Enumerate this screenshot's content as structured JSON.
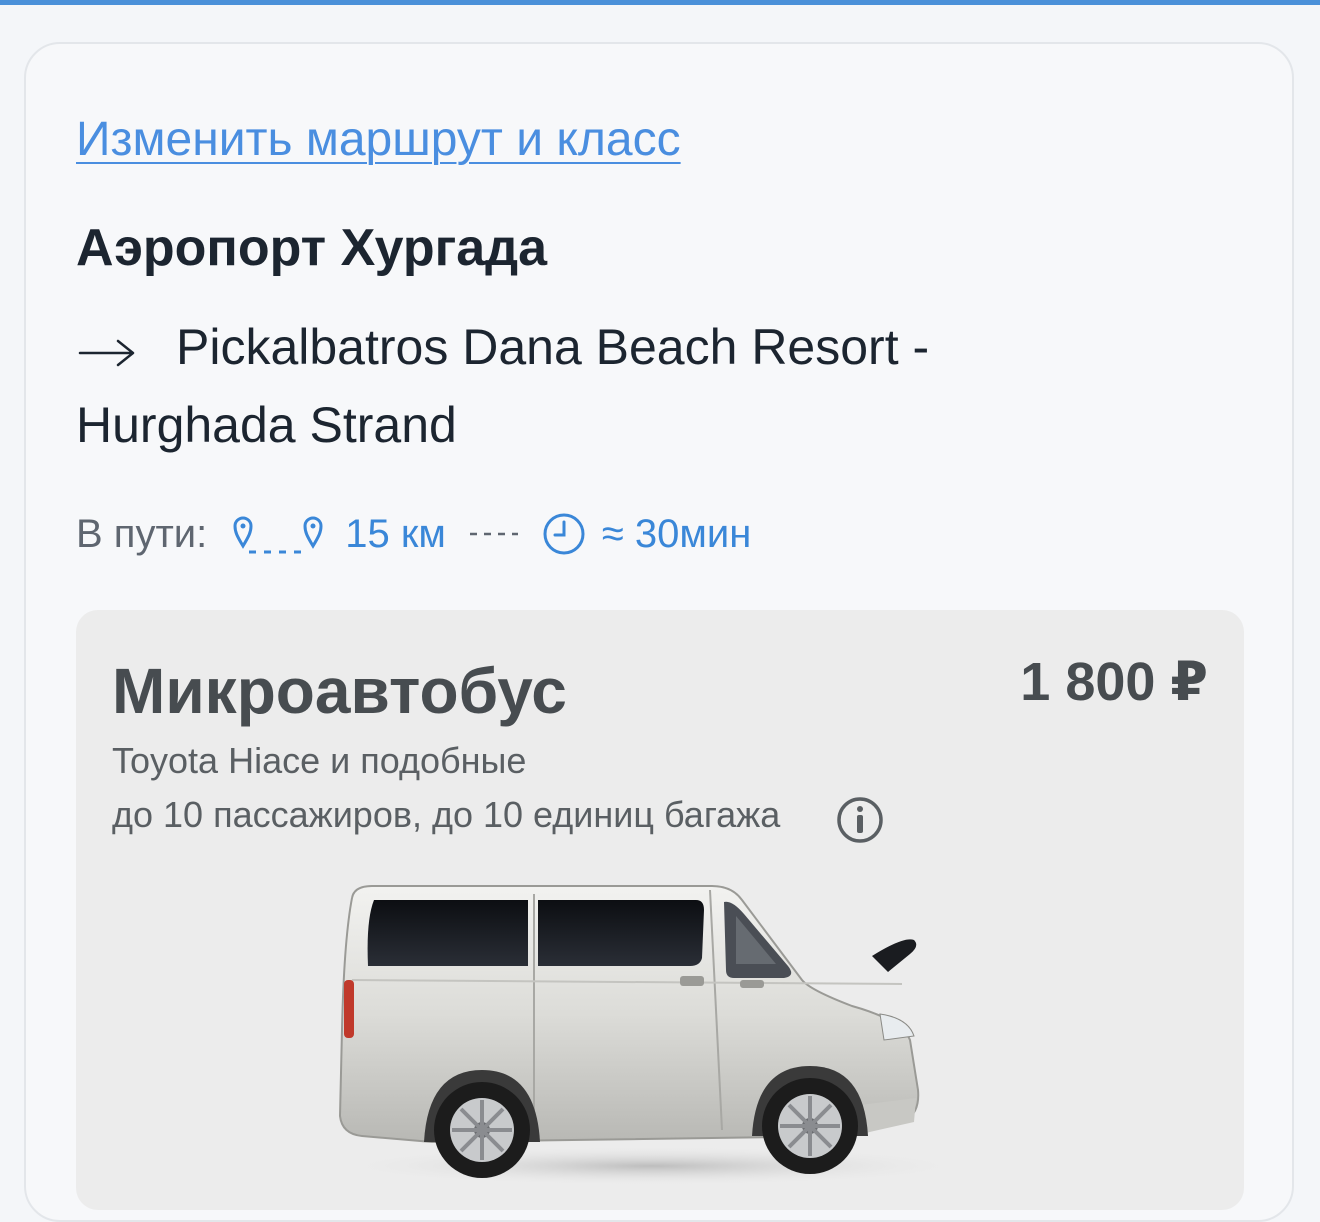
{
  "route": {
    "change_link": "Изменить маршрут и класс",
    "origin": "Аэропорт Хургада",
    "destination": "Pickalbatros Dana Beach Resort - Hurghada Strand"
  },
  "trip": {
    "label": "В пути:",
    "distance": "15 км",
    "duration": "≈ 30мин",
    "accent_color": "#3a87d8"
  },
  "vehicle": {
    "name": "Микроавтобус",
    "price": "1 800 ₽",
    "model": "Toyota Hiace и подобные",
    "capacity": "до 10 пассажиров, до 10 единиц багажа",
    "info_icon": "info-icon",
    "image": "van-image"
  },
  "colors": {
    "link": "#4a8ee0",
    "top_bar": "#4a90d9",
    "text_dark": "#1c2530"
  }
}
